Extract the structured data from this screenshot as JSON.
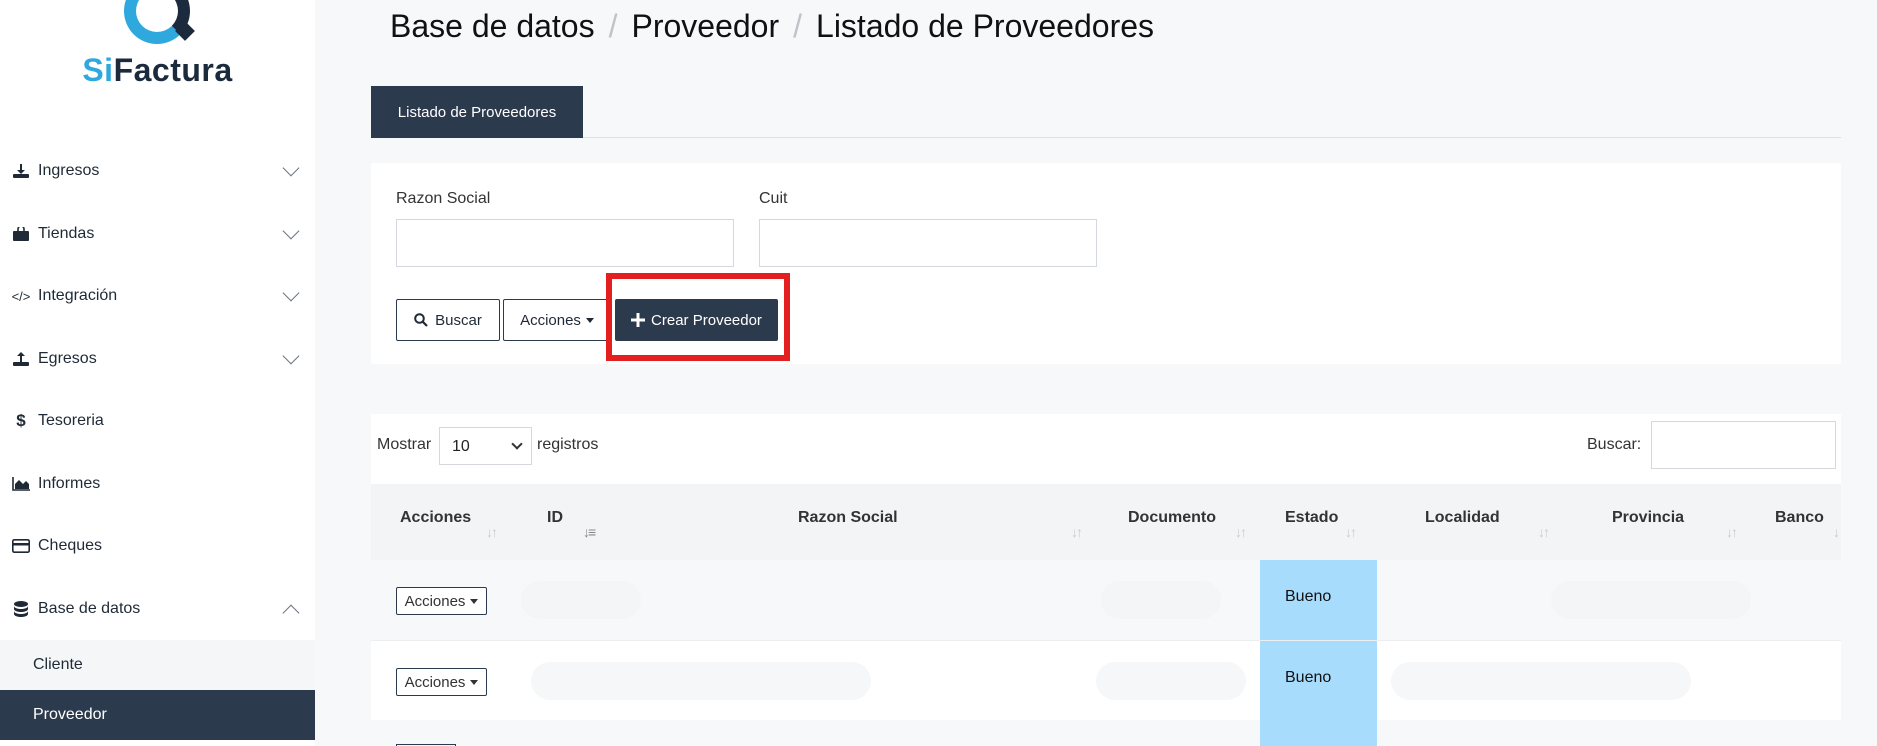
{
  "brand": {
    "prefix": "Si",
    "suffix": "Factura"
  },
  "sidebar": {
    "items": [
      {
        "label": "Ingresos",
        "icon": "download-icon",
        "expandable": true
      },
      {
        "label": "Tiendas",
        "icon": "shopping-bag-icon",
        "expandable": true
      },
      {
        "label": "Integración",
        "icon": "code-icon",
        "expandable": true
      },
      {
        "label": "Egresos",
        "icon": "upload-icon",
        "expandable": true
      },
      {
        "label": "Tesoreria",
        "icon": "dollar-icon",
        "expandable": false
      },
      {
        "label": "Informes",
        "icon": "area-chart-icon",
        "expandable": false
      },
      {
        "label": "Cheques",
        "icon": "credit-card-icon",
        "expandable": false
      },
      {
        "label": "Base de datos",
        "icon": "database-icon",
        "expandable": true,
        "expanded": true
      }
    ],
    "subitems": [
      {
        "label": "Cliente",
        "active": false
      },
      {
        "label": "Proveedor",
        "active": true
      }
    ],
    "icon_glyphs": {
      "dollar": "$",
      "code": "</>"
    }
  },
  "breadcrumb": [
    "Base de datos",
    "Proveedor",
    "Listado de Proveedores"
  ],
  "breadcrumb_sep": "/",
  "tab": {
    "label": "Listado de Proveedores"
  },
  "filters": {
    "razon_social": {
      "label": "Razon Social",
      "value": ""
    },
    "cuit": {
      "label": "Cuit",
      "value": ""
    }
  },
  "buttons": {
    "buscar": "Buscar",
    "acciones": "Acciones",
    "crear": "Crear Proveedor"
  },
  "table": {
    "length_prefix": "Mostrar",
    "length_value": "10",
    "length_suffix": "registros",
    "search_label": "Buscar:",
    "columns": [
      "Acciones",
      "ID",
      "Razon Social",
      "Documento",
      "Estado",
      "Localidad",
      "Provincia",
      "Banco"
    ],
    "rows": [
      {
        "acciones": "Acciones",
        "estado": "Bueno"
      },
      {
        "acciones": "Acciones",
        "estado": "Bueno"
      }
    ]
  },
  "colors": {
    "primary_dark": "#2c3a4e",
    "brand_blue": "#2fa8de",
    "highlight_red": "#e41f1f",
    "estado_bg": "#a8dcfd"
  }
}
